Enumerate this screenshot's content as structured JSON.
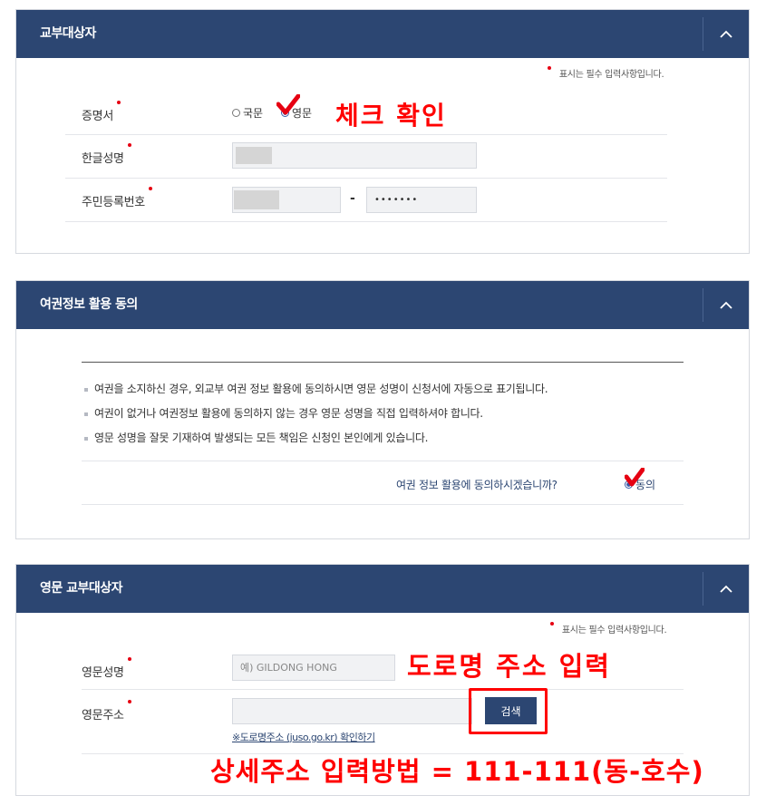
{
  "section1": {
    "title": "교부대상자",
    "required_note": "표시는 필수 입력사항입니다.",
    "certificate_label": "증명서",
    "radio_korean": "국문",
    "radio_english": "영문",
    "korean_name_label": "한글성명",
    "rrn_label": "주민등록번호",
    "rrn_dash": "-",
    "rrn_back": "•••••••",
    "annotation": "체크 확인"
  },
  "section2": {
    "title": "여권정보 활용 동의",
    "bullets": [
      "여권을 소지하신 경우, 외교부 여권 정보 활용에 동의하시면 영문 성명이 신청서에 자동으로 표기됩니다.",
      "여권이 없거나 여권정보 활용에 동의하지 않는 경우 영문 성명을 직접 입력하셔야 합니다.",
      "영문 성명을 잘못 기재하여 발생되는 모든 책임은 신청인 본인에게 있습니다."
    ],
    "question": "여권 정보 활용에 동의하시겠습니까?",
    "agree_label": "동의"
  },
  "section3": {
    "title": "영문 교부대상자",
    "required_note": "표시는 필수 입력사항입니다.",
    "english_name_label": "영문성명",
    "english_name_placeholder": "예) GILDONG HONG",
    "english_address_label": "영문주소",
    "search_button": "검색",
    "road_address_link": "※도로명주소 (juso.go.kr) 확인하기",
    "annotation_road": "도로명 주소 입력",
    "annotation_detail": "상세주소 입력방법 = 111-111(동-호수)"
  },
  "colors": {
    "header": "#2c4672",
    "annotation": "#ff0000",
    "required": "#e60012"
  }
}
